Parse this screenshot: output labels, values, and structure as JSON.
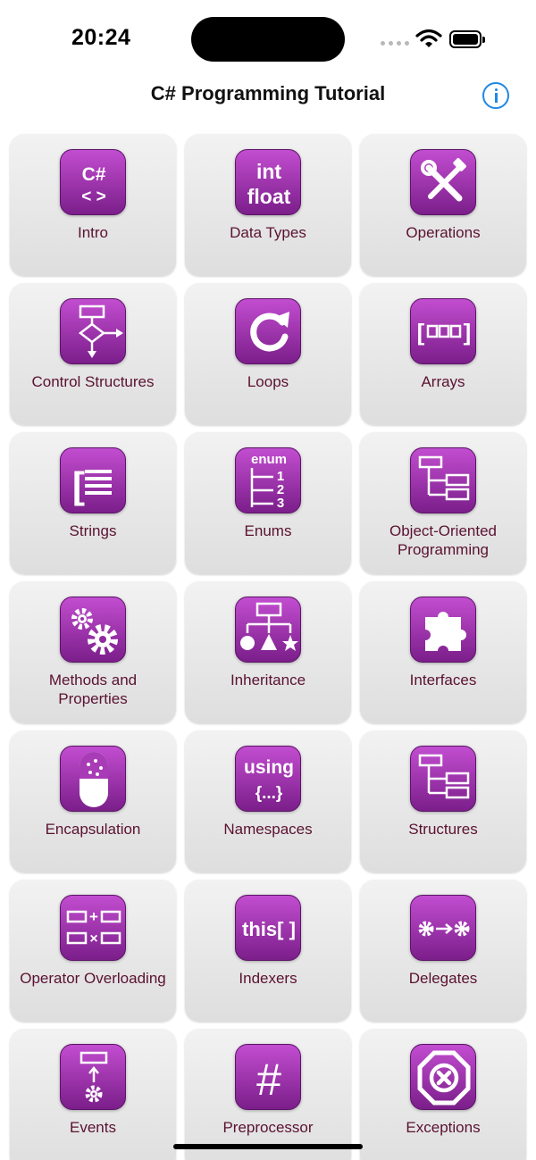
{
  "status": {
    "time": "20:24"
  },
  "nav": {
    "title": "C# Programming Tutorial"
  },
  "icon_colors": {
    "gradient_top": "#c24dd0",
    "gradient_bottom": "#7b1e8a",
    "label": "#5a1230",
    "info": "#1e88e5"
  },
  "tiles": [
    {
      "label": "Intro",
      "icon": "csharp-code-icon",
      "icon_text": [
        "C#",
        "< >"
      ]
    },
    {
      "label": "Data Types",
      "icon": "int-float-icon",
      "icon_text": [
        "int",
        "float"
      ]
    },
    {
      "label": "Operations",
      "icon": "tools-icon"
    },
    {
      "label": "Control Structures",
      "icon": "flowchart-icon"
    },
    {
      "label": "Loops",
      "icon": "loop-arrow-icon"
    },
    {
      "label": "Arrays",
      "icon": "array-icon",
      "icon_text": [
        "[",
        "]"
      ]
    },
    {
      "label": "Strings",
      "icon": "string-lines-icon",
      "icon_text": [
        "["
      ]
    },
    {
      "label": "Enums",
      "icon": "enum-list-icon",
      "icon_text": [
        "enum",
        "1",
        "2",
        "3"
      ]
    },
    {
      "label": "Object-Oriented Programming",
      "icon": "class-tree-icon"
    },
    {
      "label": "Methods and Properties",
      "icon": "gears-icon"
    },
    {
      "label": "Inheritance",
      "icon": "hierarchy-shapes-icon"
    },
    {
      "label": "Interfaces",
      "icon": "puzzle-icon"
    },
    {
      "label": "Encapsulation",
      "icon": "capsule-icon"
    },
    {
      "label": "Namespaces",
      "icon": "using-braces-icon",
      "icon_text": [
        "using",
        "{...}"
      ]
    },
    {
      "label": "Structures",
      "icon": "struct-tree-icon"
    },
    {
      "label": "Operator Overloading",
      "icon": "operator-boxes-icon",
      "icon_text": [
        "+",
        "×"
      ]
    },
    {
      "label": "Indexers",
      "icon": "this-indexer-icon",
      "icon_text": [
        "this[ ]"
      ]
    },
    {
      "label": "Delegates",
      "icon": "gear-arrow-gear-icon"
    },
    {
      "label": "Events",
      "icon": "event-trigger-icon"
    },
    {
      "label": "Preprocessor",
      "icon": "hash-icon",
      "icon_text": [
        "#"
      ]
    },
    {
      "label": "Exceptions",
      "icon": "exception-octagon-icon"
    }
  ]
}
